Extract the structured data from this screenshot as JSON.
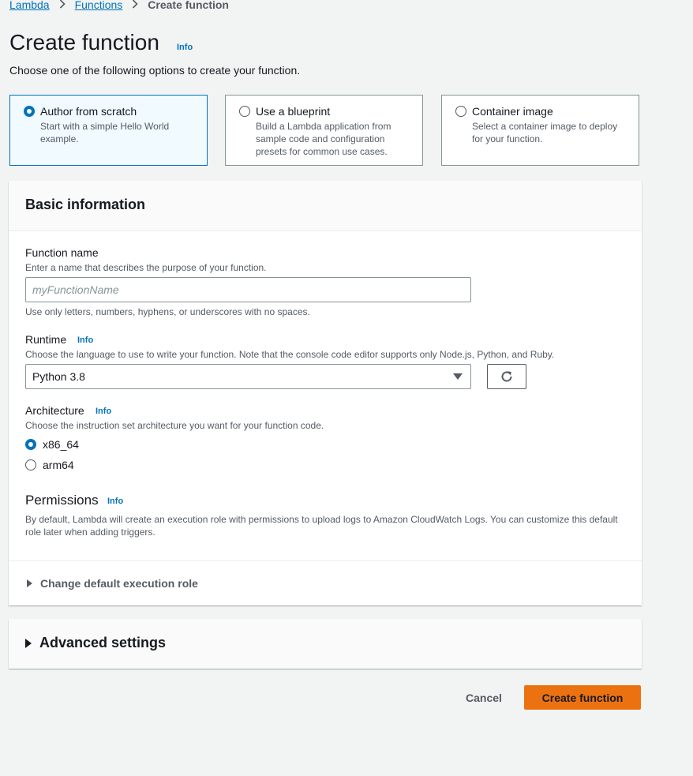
{
  "breadcrumb": {
    "items": [
      "Lambda",
      "Functions"
    ],
    "current": "Create function"
  },
  "page": {
    "title": "Create function",
    "info": "Info",
    "description": "Choose one of the following options to create your function."
  },
  "options": [
    {
      "title": "Author from scratch",
      "desc": "Start with a simple Hello World example.",
      "selected": true
    },
    {
      "title": "Use a blueprint",
      "desc": "Build a Lambda application from sample code and configuration presets for common use cases.",
      "selected": false
    },
    {
      "title": "Container image",
      "desc": "Select a container image to deploy for your function.",
      "selected": false
    }
  ],
  "basic": {
    "title": "Basic information",
    "function_name": {
      "label": "Function name",
      "description": "Enter a name that describes the purpose of your function.",
      "placeholder": "myFunctionName",
      "value": "",
      "constraint": "Use only letters, numbers, hyphens, or underscores with no spaces."
    },
    "runtime": {
      "label": "Runtime",
      "info": "Info",
      "description": "Choose the language to use to write your function. Note that the console code editor supports only Node.js, Python, and Ruby.",
      "value": "Python 3.8"
    },
    "architecture": {
      "label": "Architecture",
      "info": "Info",
      "description": "Choose the instruction set architecture you want for your function code.",
      "options": [
        "x86_64",
        "arm64"
      ],
      "selected": "x86_64"
    },
    "permissions": {
      "title": "Permissions",
      "info": "Info",
      "description": "By default, Lambda will create an execution role with permissions to upload logs to Amazon CloudWatch Logs. You can customize this default role later when adding triggers."
    },
    "change_role_label": "Change default execution role"
  },
  "advanced": {
    "label": "Advanced settings"
  },
  "actions": {
    "cancel": "Cancel",
    "create": "Create function"
  },
  "colors": {
    "accent": "#0073bb",
    "primary_button": "#ec7211",
    "background": "#f2f3f3"
  },
  "icons": {
    "breadcrumb_separator": "chevron-right-icon",
    "refresh": "refresh-icon",
    "select": "caret-down-icon",
    "expander": "triangle-right-icon"
  }
}
